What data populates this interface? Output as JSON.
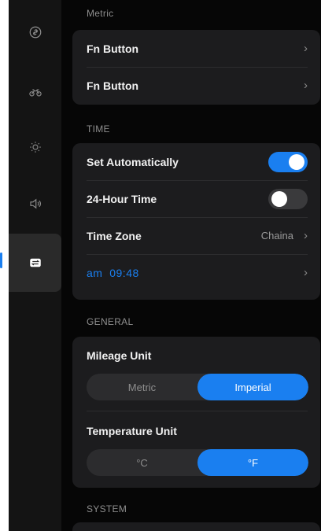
{
  "sidebar": {
    "items": [
      {
        "icon": "link-icon"
      },
      {
        "icon": "motorcycle-icon"
      },
      {
        "icon": "brightness-icon"
      },
      {
        "icon": "volume-icon"
      },
      {
        "icon": "settings-toggle-icon"
      }
    ],
    "active_index": 4
  },
  "metric_section": {
    "title": "Metric",
    "rows": [
      {
        "label": "Fn Button"
      },
      {
        "label": "Fn Button"
      }
    ]
  },
  "time_section": {
    "title": "TIME",
    "set_automatically": {
      "label": "Set Automatically",
      "state": "on"
    },
    "hour24": {
      "label": "24-Hour Time",
      "state": "off"
    },
    "time_zone": {
      "label": "Time Zone",
      "value": "Chaina"
    },
    "current_time": {
      "text": "am  09:48"
    }
  },
  "general_section": {
    "title": "GENERAL",
    "mileage": {
      "label": "Mileage Unit",
      "options": [
        "Metric",
        "Imperial"
      ],
      "selected": "Imperial"
    },
    "temperature": {
      "label": "Temperature Unit",
      "options": [
        "°C",
        "°F"
      ],
      "selected": "°F"
    }
  },
  "system_section": {
    "title": "SYSTEM"
  },
  "colors": {
    "accent": "#1a7ff0",
    "background": "#060606",
    "card": "#1c1c1e",
    "sidebar": "#141414"
  }
}
